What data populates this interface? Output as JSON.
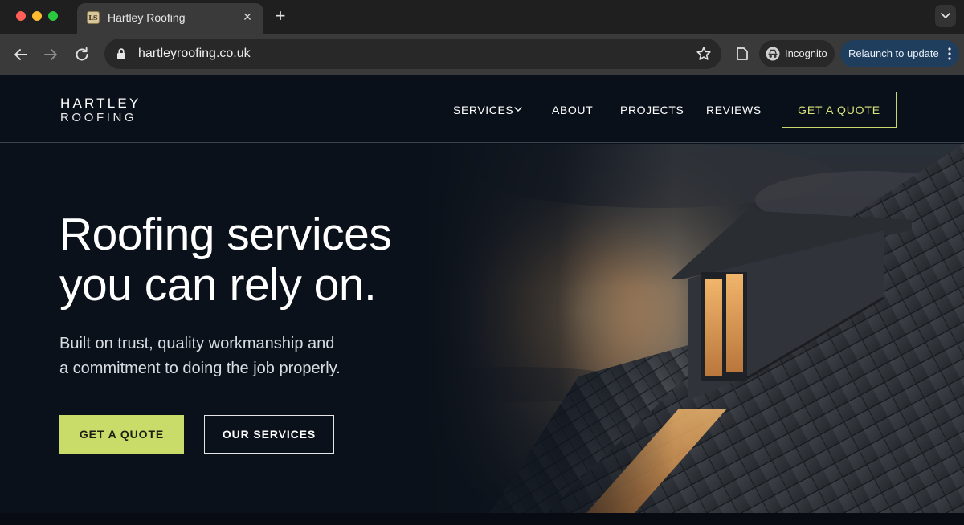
{
  "browser": {
    "tab": {
      "title": "Hartley Roofing",
      "favicon": "LS"
    },
    "url": "hartleyroofing.co.uk",
    "incognito_label": "Incognito",
    "relaunch_label": "Relaunch to update",
    "icons": {
      "back": "arrow-left-icon",
      "forward": "arrow-right-icon",
      "reload": "reload-icon",
      "lock": "lock-icon",
      "bookmark": "star-icon",
      "extension": "extension-icon",
      "incognito": "incognito-icon",
      "menu": "kebab-menu-icon"
    }
  },
  "site": {
    "logo": {
      "line1": "HARTLEY",
      "line2": "ROOFING"
    },
    "nav": {
      "services": "SERVICES",
      "about": "ABOUT",
      "projects": "PROJECTS",
      "reviews": "REVIEWS",
      "cta": "GET A QUOTE"
    },
    "hero": {
      "headline_line1": "Roofing services",
      "headline_line2": "you can rely on.",
      "sub_line1": "Built on trust, quality workmanship and",
      "sub_line2": "a commitment to doing the job properly.",
      "primary_button": "GET A QUOTE",
      "secondary_button": "OUR SERVICES"
    },
    "colors": {
      "background": "#0b111a",
      "accent": "#c9db68",
      "accent_border": "#c9d66a",
      "relaunch_bg": "#1f3d5c"
    }
  }
}
